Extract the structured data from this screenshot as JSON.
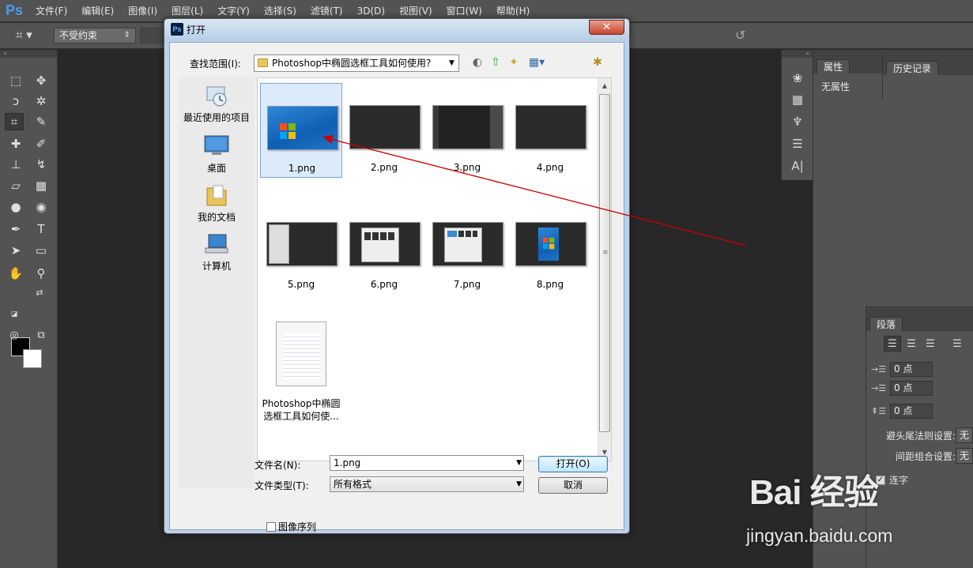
{
  "app": {
    "logo": "Ps",
    "menu": [
      "文件(F)",
      "编辑(E)",
      "图像(I)",
      "图层(L)",
      "文字(Y)",
      "选择(S)",
      "滤镜(T)",
      "3D(D)",
      "视图(V)",
      "窗口(W)",
      "帮助(H)"
    ]
  },
  "options_bar": {
    "ratio_select": "不受约束"
  },
  "toolbar": {
    "tools": [
      "marquee-icon",
      "move-icon",
      "lasso-icon",
      "magic-wand-icon",
      "crop-icon",
      "eyedropper-icon",
      "healing-icon",
      "brush-icon",
      "stamp-icon",
      "history-brush-icon",
      "eraser-icon",
      "gradient-icon",
      "blur-icon",
      "dodge-icon",
      "pen-icon",
      "type-icon",
      "path-select-icon",
      "rectangle-icon",
      "hand-icon",
      "zoom-icon"
    ],
    "foreground_color": "#000000",
    "background_color": "#ffffff"
  },
  "properties_panel": {
    "tab": "属性",
    "content": "无属性"
  },
  "history_panel": {
    "tab": "历史记录"
  },
  "paragraph_panel": {
    "tab": "段落",
    "indents": [
      "0 点",
      "0 点",
      "0 点"
    ],
    "kinsoku_label": "避头尾法则设置:",
    "kinsoku_value": "无",
    "mojikumi_label": "间距组合设置:",
    "mojikumi_value": "无",
    "hyphenate_label": "连字"
  },
  "dialog": {
    "title": "打开",
    "close": "✕",
    "look_in_label": "查找范围(I):",
    "look_in_value": "Photoshop中椭圆选框工具如何使用?",
    "places": [
      {
        "label": "最近使用的项目"
      },
      {
        "label": "桌面"
      },
      {
        "label": "我的文档"
      },
      {
        "label": "计算机"
      }
    ],
    "files": [
      {
        "name": "1.png",
        "thumb": "win7"
      },
      {
        "name": "2.png",
        "thumb": "dark"
      },
      {
        "name": "3.png",
        "thumb": "dark-ui"
      },
      {
        "name": "4.png",
        "thumb": "dark"
      },
      {
        "name": "5.png",
        "thumb": "dialog"
      },
      {
        "name": "6.png",
        "thumb": "dialog-thumbs"
      },
      {
        "name": "7.png",
        "thumb": "dialog-thumbs"
      },
      {
        "name": "8.png",
        "thumb": "win7-small"
      },
      {
        "name": "Photoshop中椭圆选框工具如何使...",
        "thumb": "document"
      }
    ],
    "file_name_label": "文件名(N):",
    "file_name_value": "1.png",
    "file_type_label": "文件类型(T):",
    "file_type_value": "所有格式",
    "open_button": "打开(O)",
    "cancel_button": "取消",
    "image_sequence_label": "图像序列"
  },
  "watermark": {
    "brand": "Bai 经验",
    "url": "jingyan.baidu.com"
  },
  "colors": {
    "annotation_arrow": "#cc0000",
    "ps_bg": "#282828",
    "ps_panel": "#535353",
    "dialog_frame": "#bcd2e8"
  }
}
